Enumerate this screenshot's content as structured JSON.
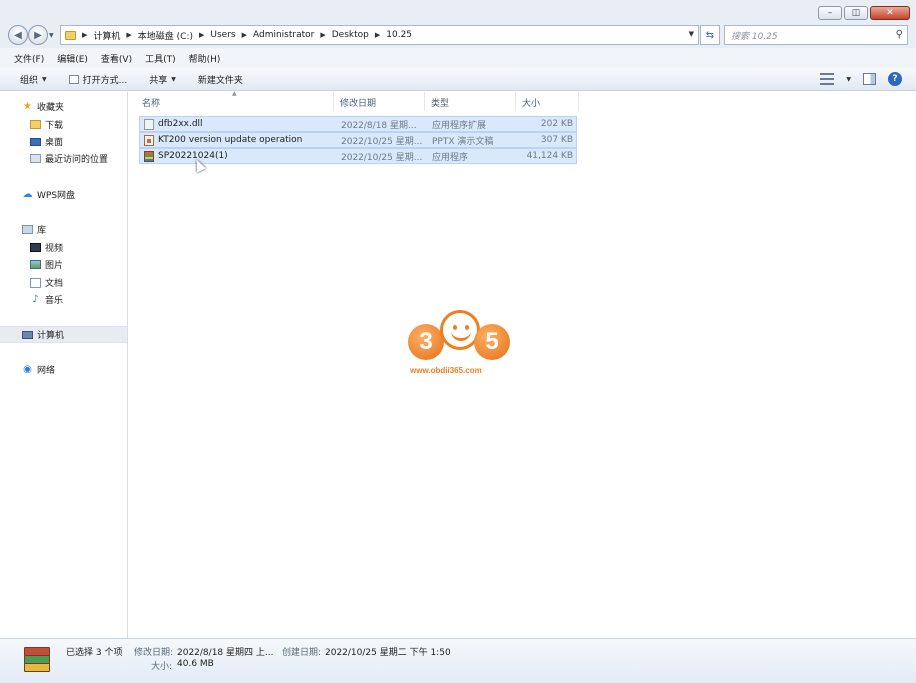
{
  "window": {
    "min_label": "▭",
    "max_label": "◫",
    "close_label": "✕"
  },
  "address": {
    "crumbs": [
      "计算机",
      "本地磁盘 (C:)",
      "Users",
      "Administrator",
      "Desktop",
      "10.25"
    ],
    "search_placeholder": "搜索 10.25"
  },
  "menu": [
    "文件(F)",
    "编辑(E)",
    "查看(V)",
    "工具(T)",
    "帮助(H)"
  ],
  "toolbar": {
    "organize": "组织",
    "open_with": "打开方式...",
    "share": "共享",
    "new_folder": "新建文件夹"
  },
  "sidebar": {
    "favorites": "收藏夹",
    "downloads": "下载",
    "desktop": "桌面",
    "recent": "最近访问的位置",
    "wps": "WPS网盘",
    "libraries": "库",
    "videos": "视频",
    "pictures": "图片",
    "documents": "文档",
    "music": "音乐",
    "computer": "计算机",
    "network": "网络"
  },
  "columns": {
    "name": "名称",
    "modified": "修改日期",
    "type": "类型",
    "size": "大小"
  },
  "files": [
    {
      "name": "dfb2xx.dll",
      "modified": "2022/8/18 星期...",
      "type": "应用程序扩展",
      "size": "202 KB",
      "icon": "dll-file-icon"
    },
    {
      "name": "KT200 version update operation",
      "modified": "2022/10/25 星期...",
      "type": "PPTX 演示文稿",
      "size": "307 KB",
      "icon": "pptx-file-icon"
    },
    {
      "name": "SP20221024(1)",
      "modified": "2022/10/25 星期...",
      "type": "应用程序",
      "size": "41,124 KB",
      "icon": "exe-file-icon"
    }
  ],
  "watermark": {
    "digit1": "3",
    "digit2": "5",
    "url": "www.obdii365.com"
  },
  "details": {
    "selected": "已选择 3 个项",
    "modified_label": "修改日期:",
    "modified_value": "2022/8/18 星期四 上...",
    "created_label": "创建日期:",
    "created_value": "2022/10/25 星期二 下午 1:50",
    "size_label": "大小:",
    "size_value": "40.6 MB"
  }
}
